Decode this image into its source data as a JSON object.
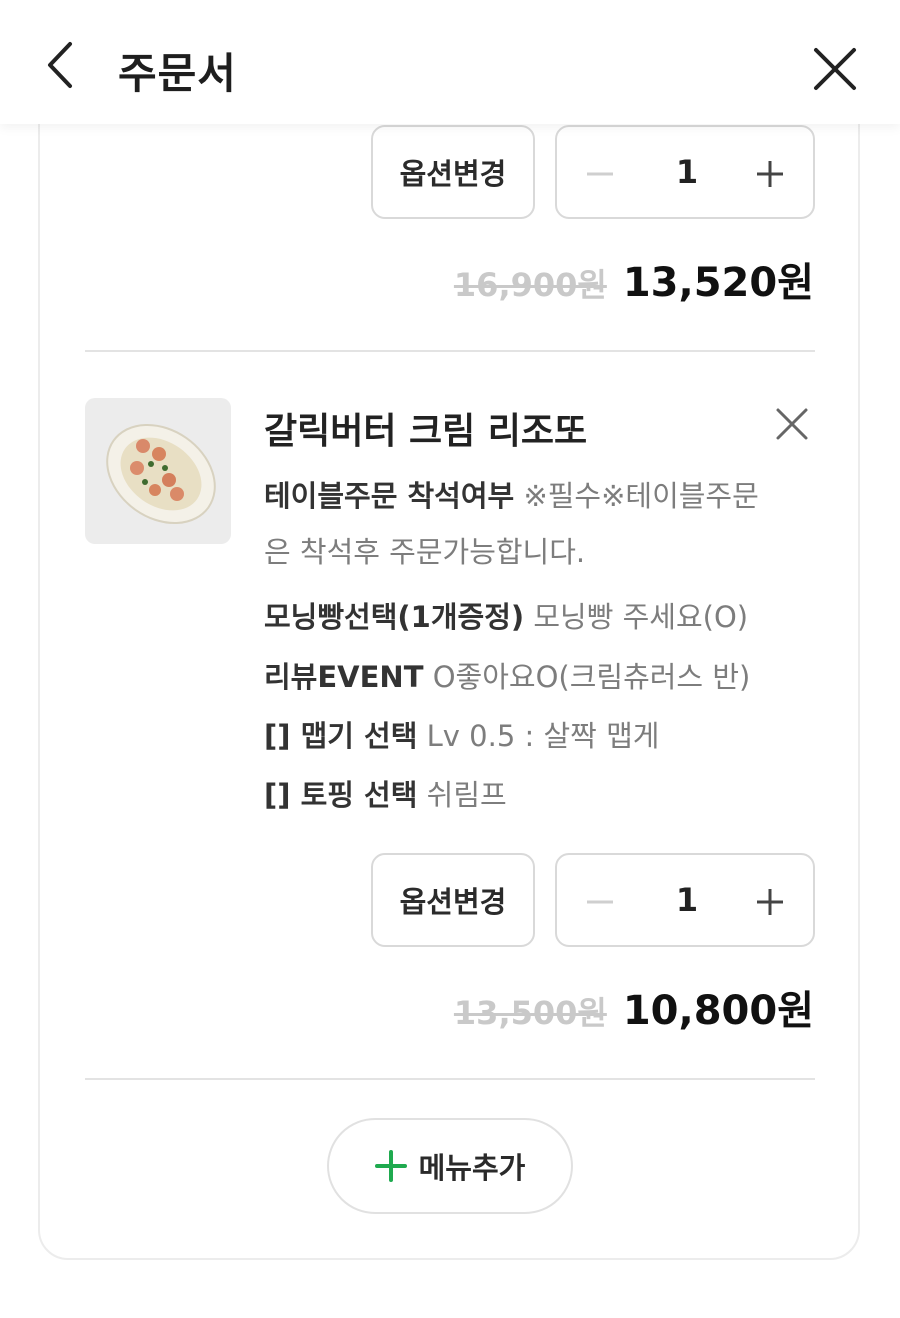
{
  "header": {
    "title": "주문서"
  },
  "items": [
    {
      "option_change_label": "옵션변경",
      "quantity": "1",
      "original_price": "16,900원",
      "sale_price": "13,520원"
    },
    {
      "name": "갈릭버터 크림 리조또",
      "option_change_label": "옵션변경",
      "quantity": "1",
      "original_price": "13,500원",
      "sale_price": "10,800원",
      "options": [
        {
          "key": "테이블주문 착석여부",
          "value": "※필수※테이블주문은 착석후 주문가능합니다."
        },
        {
          "key": "모닝빵선택(1개증정)",
          "value": "모닝빵 주세요(O)"
        },
        {
          "key": "리뷰EVENT",
          "value": "O좋아요O(크림츄러스 반)"
        },
        {
          "key": "[] 맵기 선택",
          "value": "Lv 0.5 : 살짝 맵게"
        },
        {
          "key": "[] 토핑 선택",
          "value": "쉬림프"
        }
      ]
    }
  ],
  "add_menu_label": "메뉴추가",
  "colors": {
    "accent": "#1faa4f",
    "strike": "#c9c9c9",
    "border": "#d9d9d9"
  }
}
